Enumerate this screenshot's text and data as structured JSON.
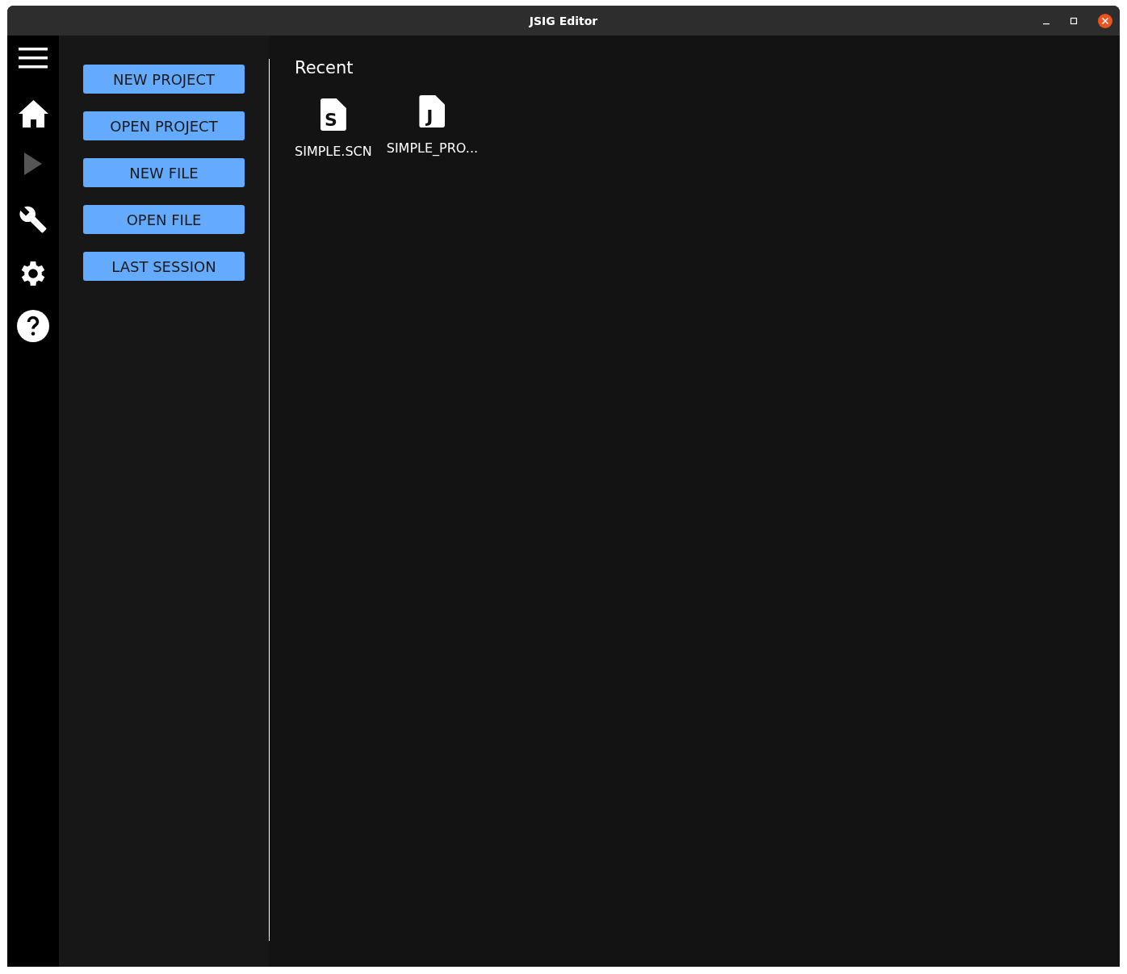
{
  "window": {
    "title": "JSIG Editor"
  },
  "sidebar": {
    "items": [
      {
        "kind": "menu",
        "disabled": false
      },
      {
        "kind": "home",
        "disabled": false
      },
      {
        "kind": "play",
        "disabled": true
      },
      {
        "kind": "wrench",
        "disabled": false
      },
      {
        "kind": "gear",
        "disabled": false
      },
      {
        "kind": "help",
        "disabled": false
      }
    ]
  },
  "actions": [
    "NEW PROJECT",
    "OPEN PROJECT",
    "NEW FILE",
    "OPEN FILE",
    "LAST SESSION"
  ],
  "recent": {
    "title": "Recent",
    "files": [
      {
        "letter": "S",
        "name": "SIMPLE.SCN"
      },
      {
        "letter": "J",
        "name": "SIMPLE_PRO..."
      }
    ]
  }
}
